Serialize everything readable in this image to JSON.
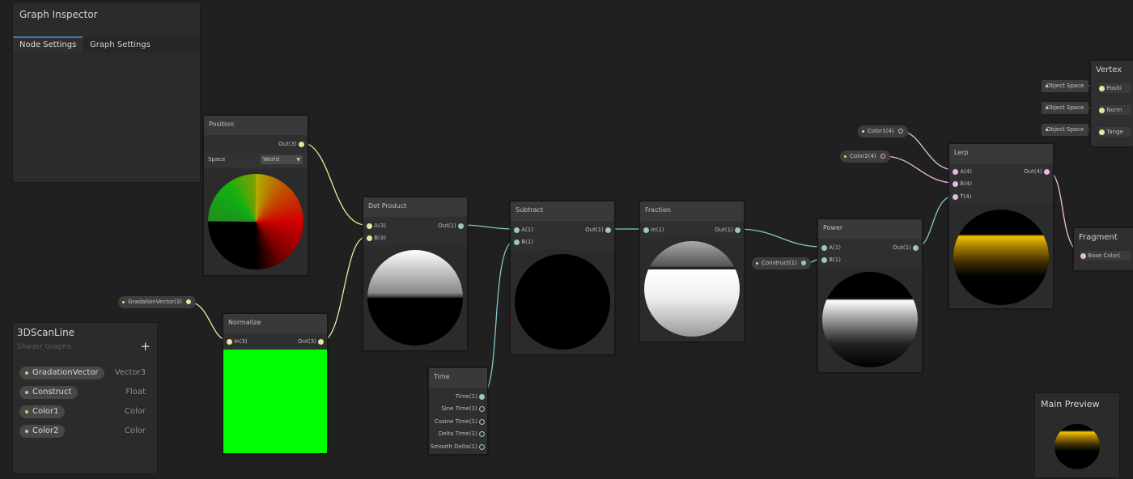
{
  "inspector": {
    "title": "Graph Inspector",
    "tabs": [
      "Node Settings",
      "Graph Settings"
    ]
  },
  "blackboard": {
    "title": "3DScanLine",
    "subtitle": "Shader Graphs",
    "add_label": "+",
    "properties": [
      {
        "name": "GradationVector",
        "type": "Vector3"
      },
      {
        "name": "Construct",
        "type": "Float"
      },
      {
        "name": "Color1",
        "type": "Color"
      },
      {
        "name": "Color2",
        "type": "Color"
      }
    ]
  },
  "nodes": {
    "position": {
      "title": "Position",
      "out": "Out(3)",
      "space_label": "Space",
      "space_value": "World"
    },
    "normalize": {
      "title": "Normalize",
      "in": "In(3)",
      "out": "Out(3)"
    },
    "dot_product": {
      "title": "Dot Product",
      "a": "A(3)",
      "b": "B(3)",
      "out": "Out(1)"
    },
    "subtract": {
      "title": "Subtract",
      "a": "A(1)",
      "b": "B(1)",
      "out": "Out(1)"
    },
    "fraction": {
      "title": "Fraction",
      "in": "In(1)",
      "out": "Out(1)"
    },
    "power": {
      "title": "Power",
      "a": "A(1)",
      "b": "B(1)",
      "out": "Out(1)"
    },
    "lerp": {
      "title": "Lerp",
      "a": "A(4)",
      "b": "B(4)",
      "t": "T(4)",
      "out": "Out(4)"
    },
    "time": {
      "title": "Time",
      "outputs": [
        "Time(1)",
        "Sine Time(1)",
        "Cosine Time(1)",
        "Delta Time(1)",
        "Smooth Delta(1)"
      ]
    },
    "vertex": {
      "title": "Vertex",
      "ports": [
        "Positi",
        "Norm",
        "Tange"
      ]
    },
    "fragment": {
      "title": "Fragment",
      "port": "Base Color("
    }
  },
  "pills": {
    "gradation": "GradationVector(3)",
    "construct": "Construct(1)",
    "color1": "Color1(4)",
    "color2": "Color2(4)",
    "object_space": "Object Space"
  },
  "main_preview": {
    "title": "Main Preview"
  },
  "colors": {
    "wire_float": "#84e4e7",
    "wire_vec3": "#f6ff9a",
    "wire_vec4": "#fbcbf4",
    "accent_tab": "#3a79bb"
  }
}
